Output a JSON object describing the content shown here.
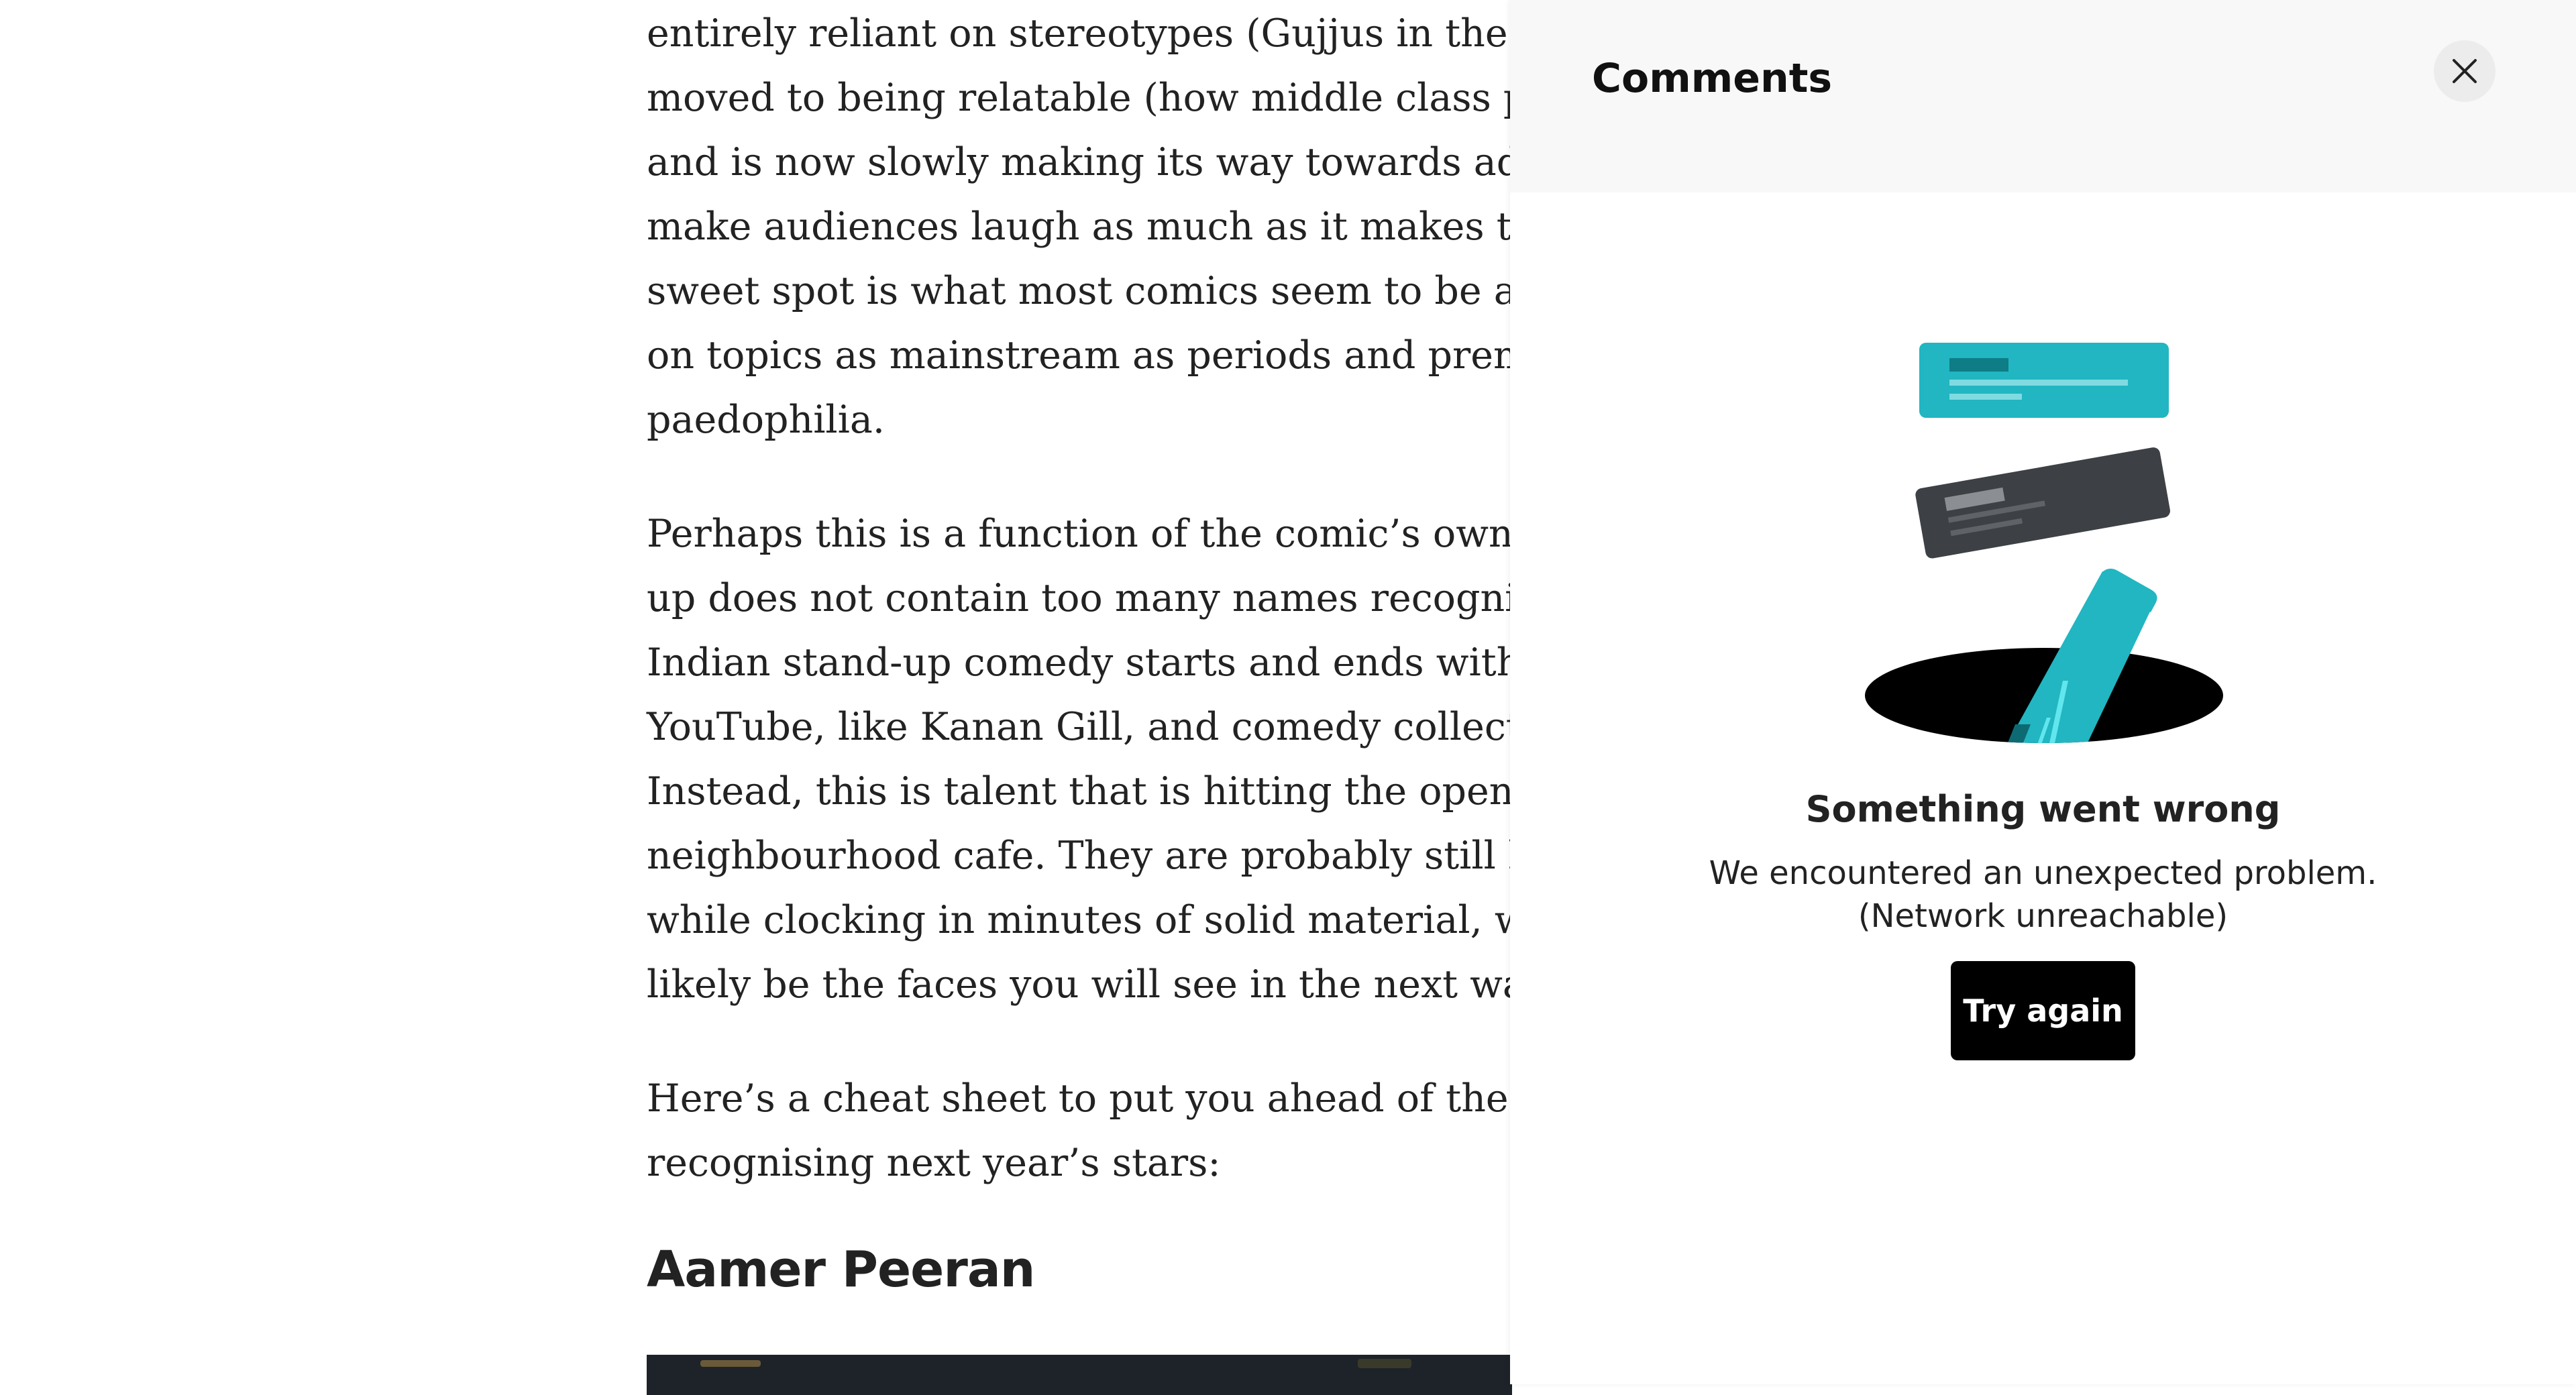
{
  "article": {
    "paragraph1": [
      "entirely reliant on stereotypes (Gujjus in the house",
      "moved to being relatable (how middle class people",
      "and is now slowly making its way towards address",
      "make audiences laugh as much as it makes them u",
      "sweet spot is what most comics seem to be aiming",
      "on topics as mainstream as periods and premarita",
      "paedophilia."
    ],
    "paragraph2": [
      "Perhaps this is a function of the comic’s own indep",
      "up does not contain too many names recognisable",
      "Indian stand-up comedy starts and ends with stars",
      "YouTube, like Kanan Gill, and comedy collectives li",
      "Instead, this is talent that is hitting the open mic ci",
      "neighbourhood cafe. They are probably still holdin",
      "while clocking in minutes of solid material, week a",
      "likely be the faces you will see in the next wave of"
    ],
    "paragraph3": [
      "Here’s a cheat sheet to put you ahead of the curve",
      "recognising next year’s stars:"
    ],
    "heading": "Aamer Peeran"
  },
  "comments_panel": {
    "title": "Comments",
    "close_icon": "close-icon",
    "illustration_icon": "comments-falling-into-hole-illustration",
    "error_title": "Something went wrong",
    "error_message_line1": "We encountered an unexpected problem.",
    "error_message_line2": "(Network unreachable)",
    "retry_label": "Try again"
  },
  "colors": {
    "teal": "#21b6c1",
    "dark_card": "#3d4044",
    "header_bg": "#f8f8f8",
    "button_bg": "#000000"
  }
}
